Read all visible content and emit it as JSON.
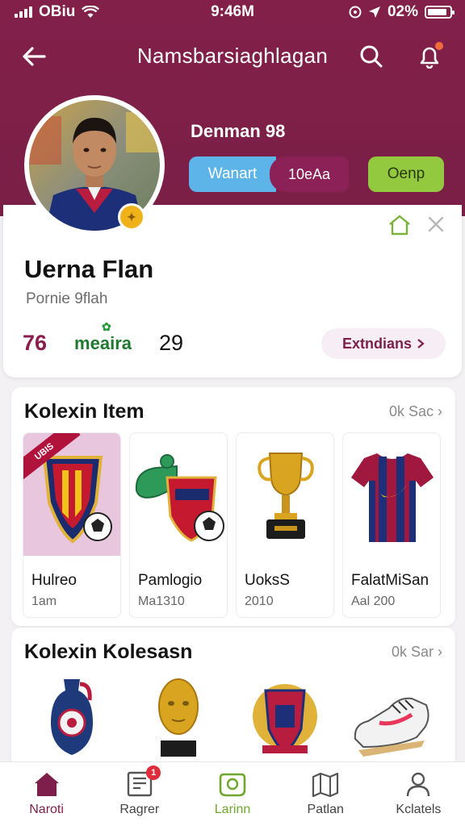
{
  "status_bar": {
    "carrier": "OBiu",
    "time": "9:46M",
    "battery_pct": "02%",
    "battery_level": 0.9
  },
  "navbar": {
    "title": "Namsbarsiaghlagan"
  },
  "header": {
    "player_name": "Denman 98",
    "chip_left": "Wanart",
    "chip_right": "10eAa",
    "open_button": "Oenp"
  },
  "profile": {
    "full_name": "Uerna Flan",
    "subtitle": "Pornie 9flah",
    "stats": [
      "76",
      "meaira",
      "29"
    ],
    "extensions_button": "Extndians"
  },
  "sections": [
    {
      "title": "Kolexin Item",
      "more": "0k Sac",
      "items": [
        {
          "name": "Hulreo",
          "sub": "1am",
          "tag": "UBIS"
        },
        {
          "name": "Pamlogio",
          "sub": "Ma1310"
        },
        {
          "name": "UoksS",
          "sub": "2010"
        },
        {
          "name": "FalatMiSan",
          "sub": "Aal 200"
        }
      ]
    },
    {
      "title": "Kolexin Kolesasn",
      "more": "0k Sar",
      "items": [
        {
          "name": "",
          "sub": ""
        },
        {
          "name": "",
          "sub": ""
        },
        {
          "name": "",
          "sub": ""
        },
        {
          "name": "",
          "sub": ""
        }
      ]
    }
  ],
  "bottom_nav": [
    {
      "label": "Naroti",
      "icon": "home-icon"
    },
    {
      "label": "Ragrer",
      "icon": "news-icon",
      "badge": "1"
    },
    {
      "label": "Larinn",
      "icon": "shop-icon"
    },
    {
      "label": "Patlan",
      "icon": "map-icon"
    },
    {
      "label": "Kclatels",
      "icon": "profile-icon"
    }
  ],
  "colors": {
    "primary": "#82204a",
    "accent_green": "#93c93e",
    "accent_blue": "#5cb4e8"
  }
}
